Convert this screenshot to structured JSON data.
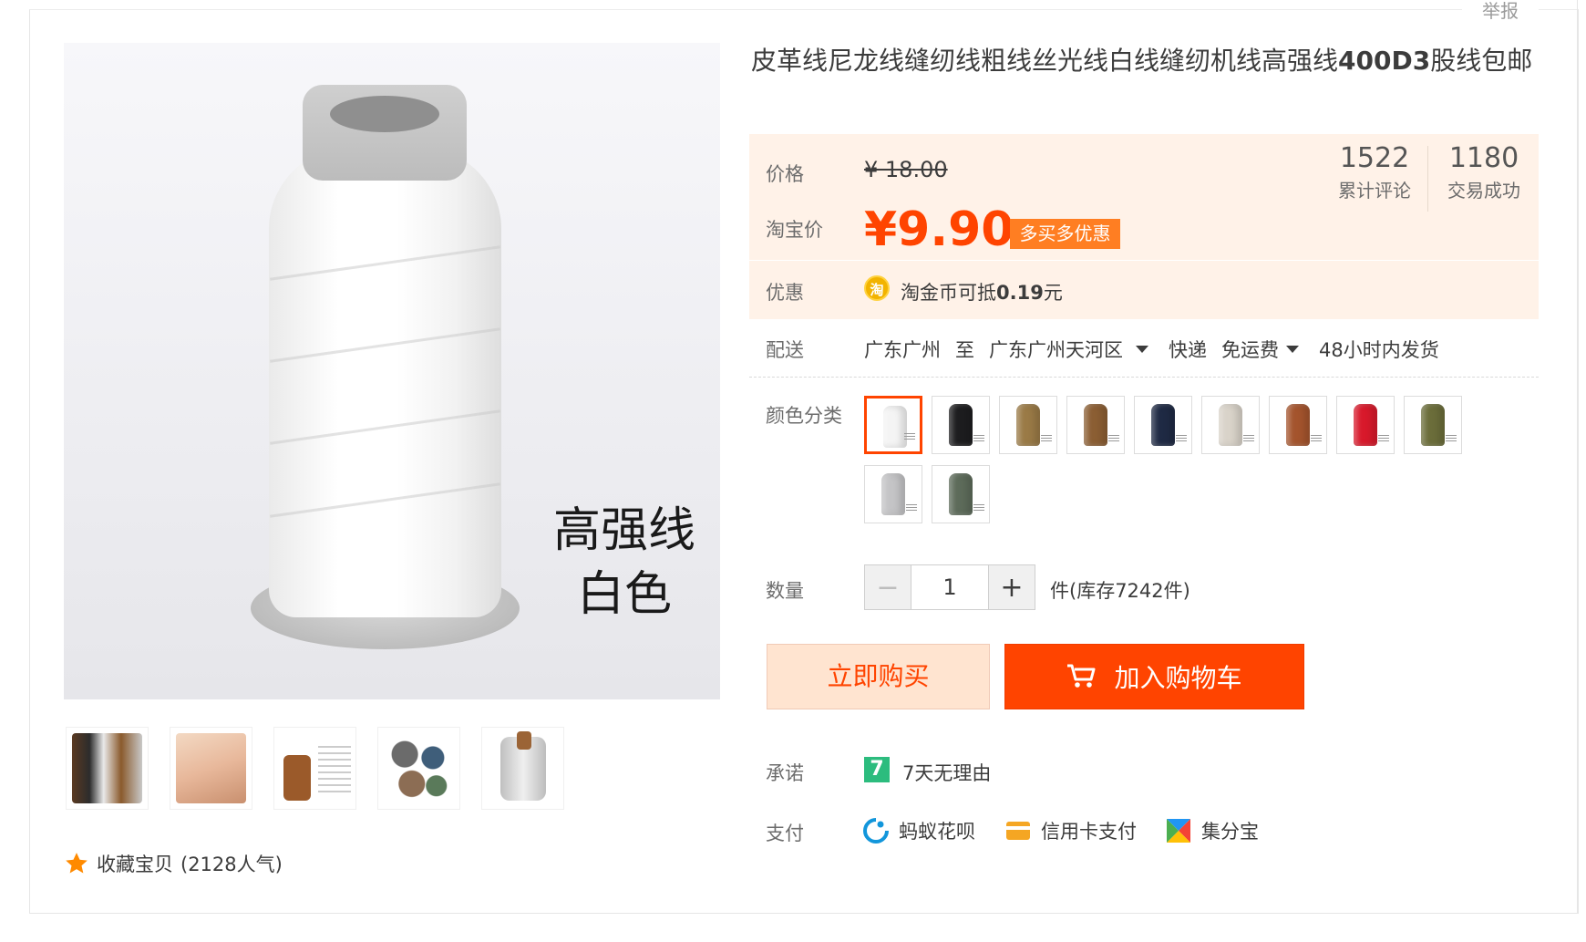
{
  "report_label": "举报",
  "product": {
    "title_prefix": "皮革线尼龙线缝纫线粗线丝光线白线缝纫机线高强线",
    "title_bold": "400D3",
    "title_suffix": "股线包邮",
    "image_caption_line1": "高强线",
    "image_caption_line2": "白色"
  },
  "price": {
    "label": "价格",
    "original": "¥ 18.00",
    "taobao_label": "淘宝价",
    "current": "¥9.90",
    "promo_tag": "多买多优惠"
  },
  "stats": [
    {
      "number": "1522",
      "label": "累计评论"
    },
    {
      "number": "1180",
      "label": "交易成功"
    }
  ],
  "coupon": {
    "label": "优惠",
    "icon_text": "淘",
    "text_prefix": "淘金币可抵",
    "amount": "0.19",
    "unit": "元"
  },
  "delivery": {
    "label": "配送",
    "from": "广东广州",
    "to_word": "至",
    "to": "广东广州天河区",
    "method": "快递",
    "fee": "免运费",
    "ship_time": "48小时内发货"
  },
  "color": {
    "label": "颜色分类",
    "swatches": [
      {
        "name": "white",
        "color": "#f4f4f4",
        "selected": true
      },
      {
        "name": "black",
        "color": "#1d1d1f"
      },
      {
        "name": "khaki",
        "color": "#9a7a46"
      },
      {
        "name": "brown",
        "color": "#8b5e33"
      },
      {
        "name": "navy",
        "color": "#1f2a44"
      },
      {
        "name": "beige",
        "color": "#d9d3c9"
      },
      {
        "name": "rust",
        "color": "#a4542d"
      },
      {
        "name": "red",
        "color": "#d8192b"
      },
      {
        "name": "olive",
        "color": "#6b6d3a"
      },
      {
        "name": "silver",
        "color": "#c4c4c6"
      },
      {
        "name": "green-grey",
        "color": "#5d6b5a"
      }
    ]
  },
  "quantity": {
    "label": "数量",
    "minus": "−",
    "value": "1",
    "plus": "+",
    "stock_text": "件(库存7242件)"
  },
  "actions": {
    "buy_now": "立即购买",
    "add_to_cart": "加入购物车"
  },
  "promise": {
    "label": "承诺",
    "icon_text": "7",
    "text": "7天无理由"
  },
  "payment": {
    "label": "支付",
    "methods": [
      {
        "name": "蚂蚁花呗",
        "color": "#1296db"
      },
      {
        "name": "信用卡支付",
        "color": "#f5a623"
      },
      {
        "name": "集分宝",
        "color": "#4caf50"
      }
    ]
  },
  "favorite": {
    "text": "收藏宝贝",
    "count": "(2128人气)"
  }
}
